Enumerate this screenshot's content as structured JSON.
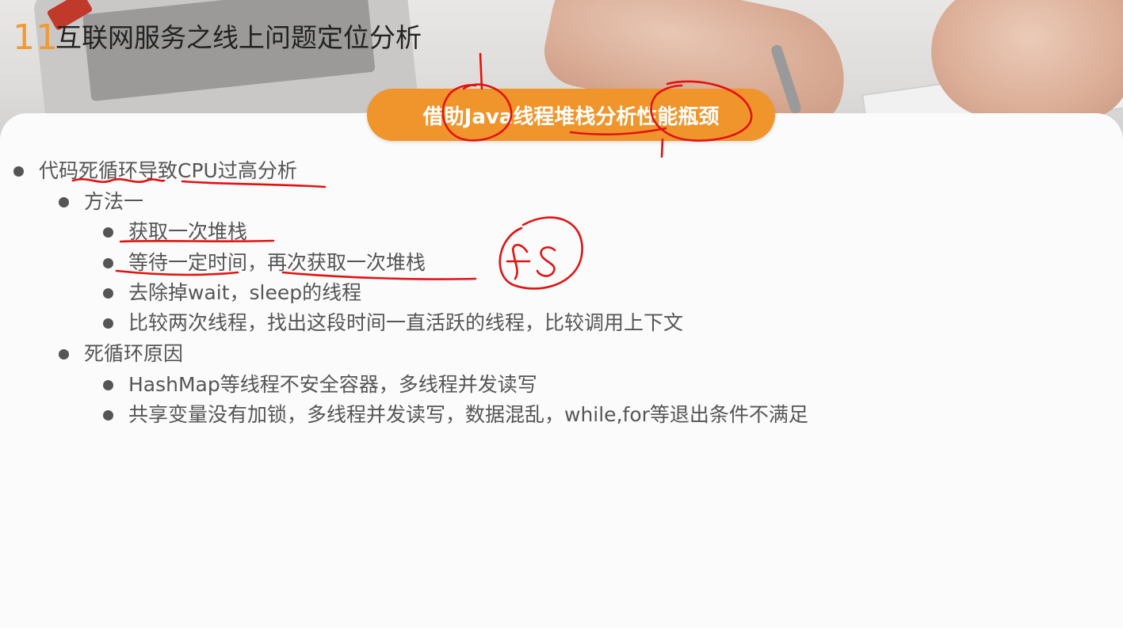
{
  "slide": {
    "number": "11",
    "title": "互联网服务之线上问题定位分析",
    "banner": "借助Java线程堆栈分析性能瓶颈",
    "accent_color": "#f0952c",
    "annotation_color": "#e31212",
    "handwriting": "FS"
  },
  "outline": {
    "main": "代码死循环导致CPU过高分析",
    "method_title": "方法一",
    "steps": [
      "获取一次堆栈",
      "等待一定时间，再次获取一次堆栈",
      "去除掉wait，sleep的线程",
      "比较两次线程，找出这段时间一直活跃的线程，比较调用上下文"
    ],
    "cause_title": "死循环原因",
    "causes": [
      "HashMap等线程不安全容器，多线程并发读写",
      "共享变量没有加锁，多线程并发读写，数据混乱，while,for等退出条件不满足"
    ]
  }
}
